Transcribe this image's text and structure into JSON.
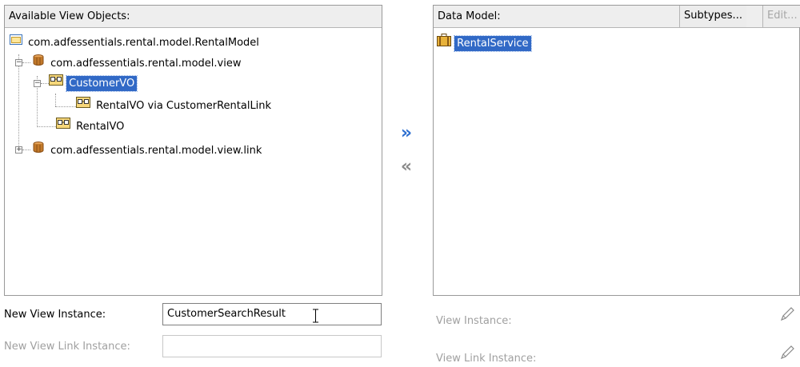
{
  "available": {
    "header": "Available View Objects:",
    "tree": {
      "root": "com.adfessentials.rental.model.RentalModel",
      "pkg_view": "com.adfessentials.rental.model.view",
      "customer_vo": "CustomerVO",
      "rental_via_link": "RentalVO via CustomerRentalLink",
      "rental_vo": "RentalVO",
      "pkg_view_link": "com.adfessentials.rental.model.view.link"
    }
  },
  "data_model": {
    "header": "Data Model:",
    "subtypes_label": "Subtypes...",
    "edit_label": "Edit...",
    "items": [
      "RentalService"
    ]
  },
  "controls": {
    "add_glyph": "»",
    "remove_glyph": "«"
  },
  "form": {
    "new_view_instance_label": "New View Instance:",
    "new_view_instance_value": "CustomerSearchResult",
    "new_view_link_instance_label": "New View Link Instance:",
    "new_view_link_instance_value": "",
    "view_instance_label": "View Instance:",
    "view_link_instance_label": "View Link Instance:"
  },
  "colors": {
    "selection": "#3169c6",
    "package_icon": "#c27a2b",
    "vo_icon": "#f0b72f",
    "arrow_blue": "#2e6fd0",
    "arrow_gray": "#8a8a8a"
  }
}
